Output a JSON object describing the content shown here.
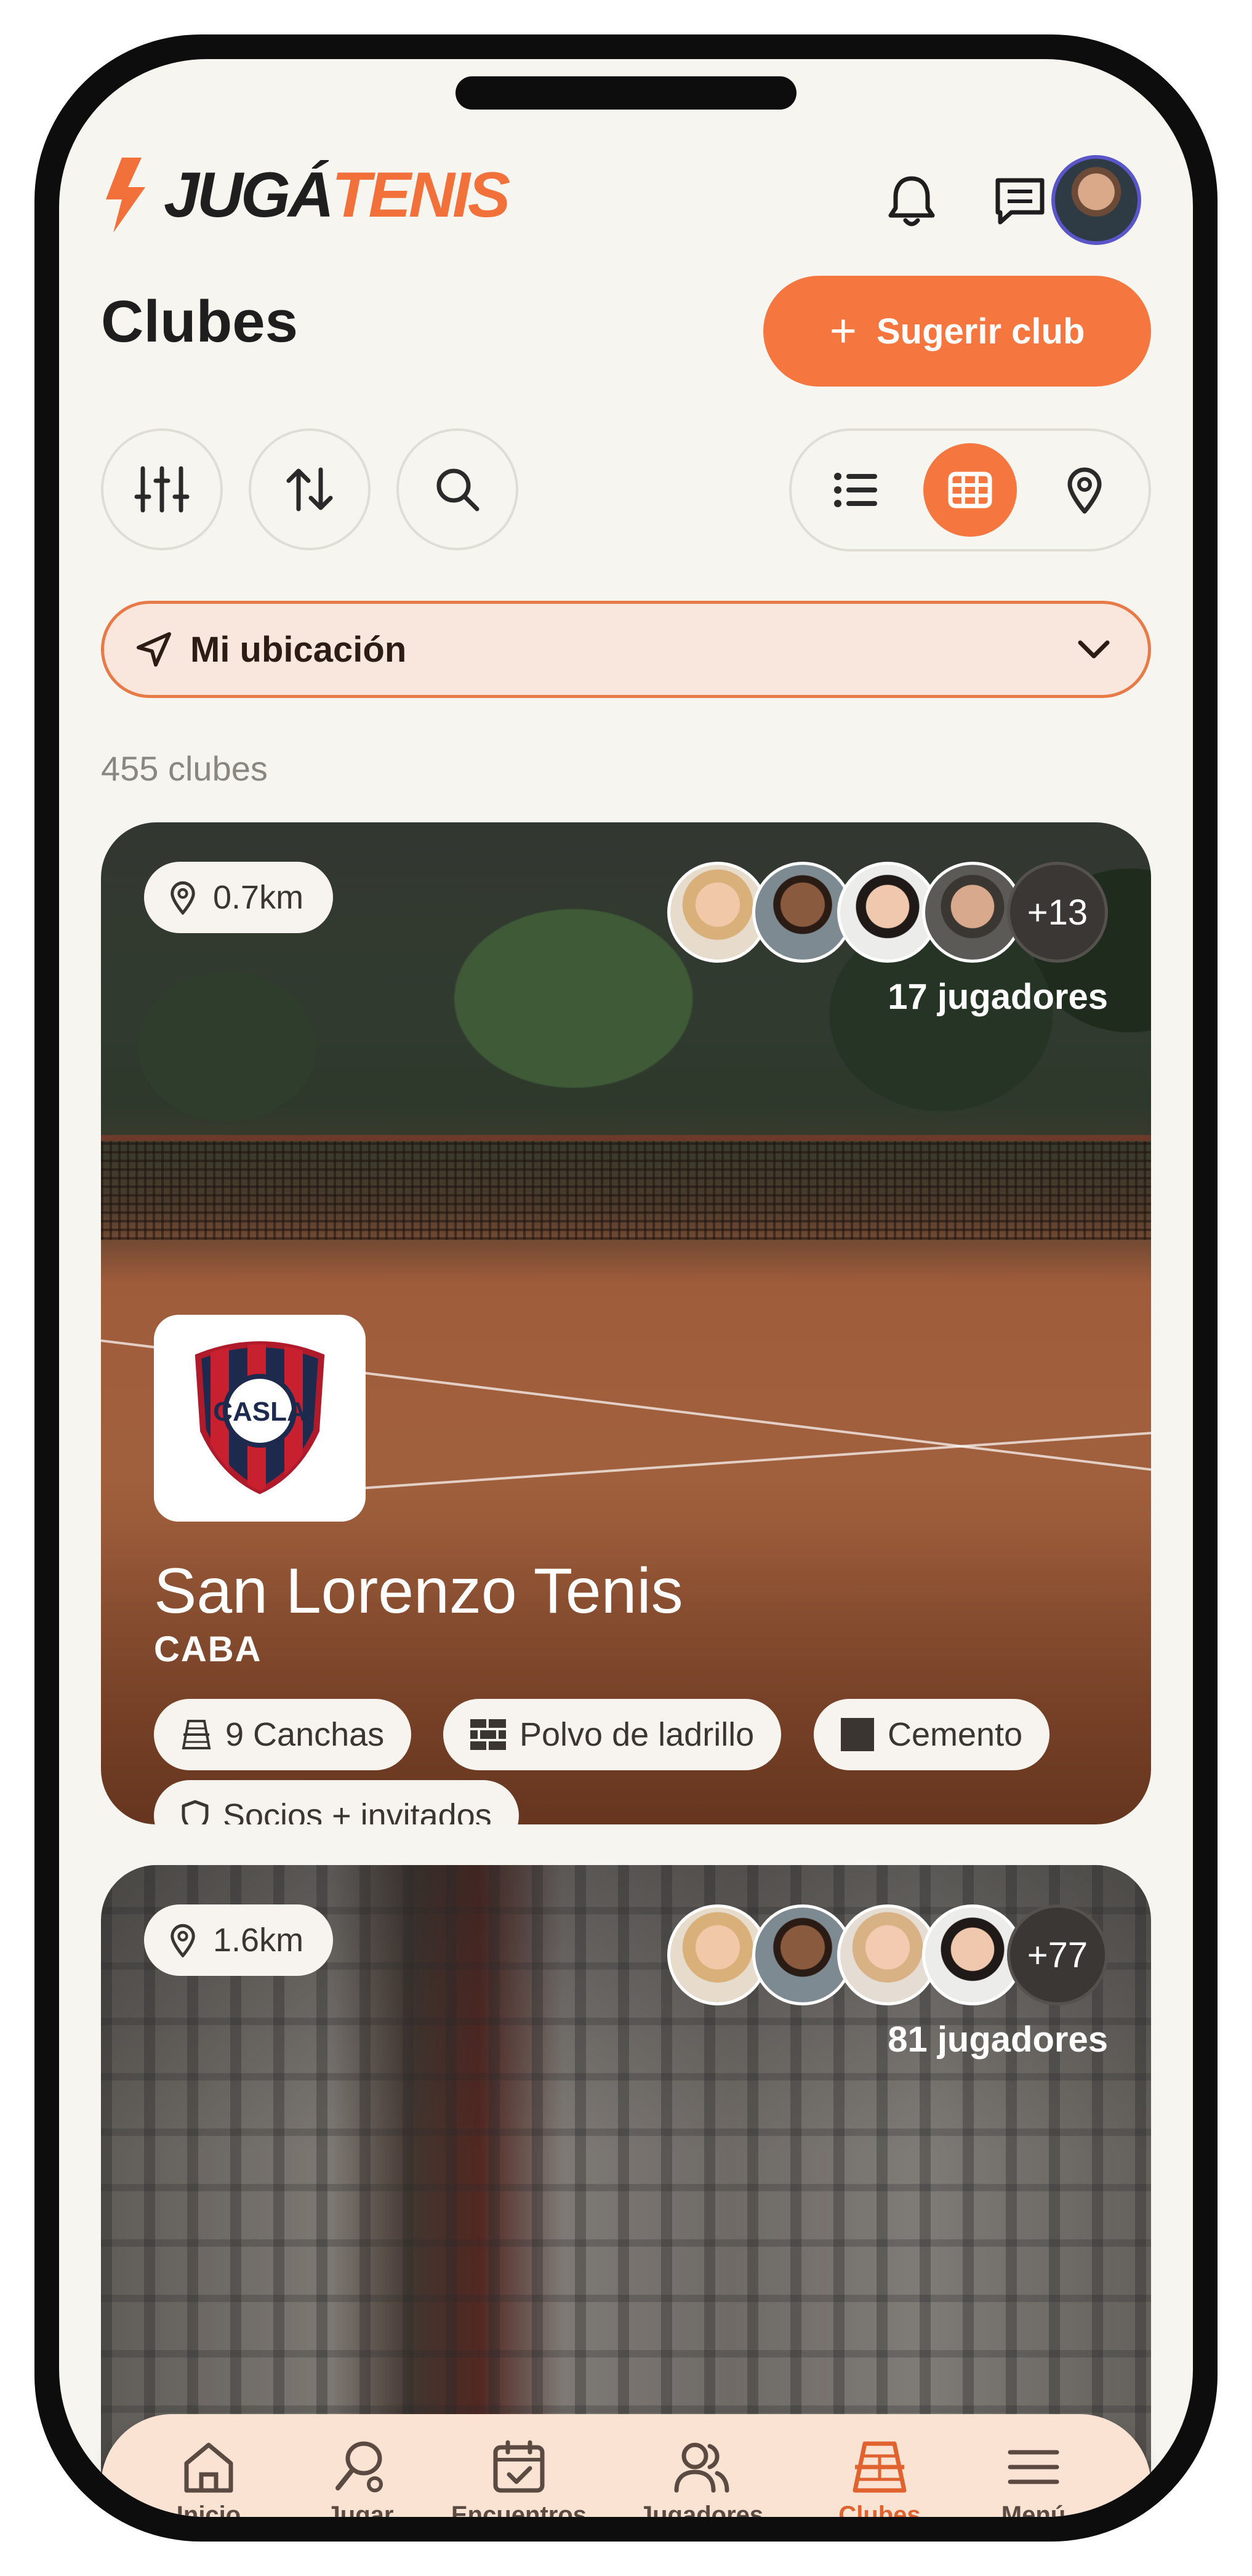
{
  "app": {
    "logo_part1": "JUGÁ",
    "logo_part2": "TENIS",
    "brand_color": "#f5763e"
  },
  "header": {
    "notifications_icon": "bell-icon",
    "messages_icon": "chat-icon"
  },
  "page": {
    "title": "Clubes",
    "suggest_button": "Sugerir club",
    "location_filter": "Mi ubicación",
    "results_count": "455 clubes"
  },
  "toolbar": {
    "buttons": [
      "filters-icon",
      "sort-icon",
      "search-icon"
    ],
    "view_modes": [
      "list",
      "grid",
      "map"
    ],
    "active_view": "grid"
  },
  "clubs": [
    {
      "distance": "0.7km",
      "more_players": "+13",
      "players_label": "17 jugadores",
      "name": "San Lorenzo Tenis",
      "city": "CABA",
      "chips": [
        "9 Canchas",
        "Polvo de ladrillo",
        "Cemento",
        "Socios + invitados"
      ]
    },
    {
      "distance": "1.6km",
      "more_players": "+77",
      "players_label": "81 jugadores"
    }
  ],
  "nav": {
    "items": [
      "Inicio",
      "Jugar",
      "Encuentros",
      "Jugadores",
      "Clubes",
      "Menú"
    ],
    "active": "Clubes"
  }
}
